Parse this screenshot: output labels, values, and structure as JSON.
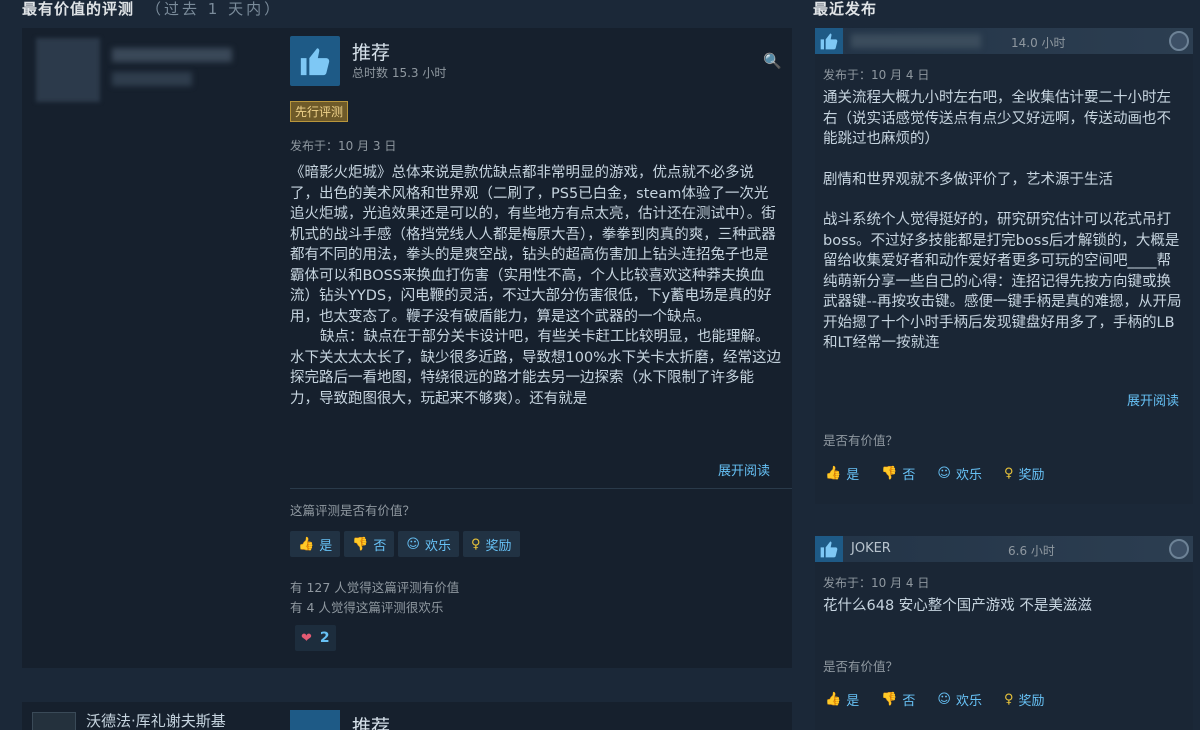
{
  "left_section": {
    "title": "最有价值的评测",
    "subtitle": "（过去 1 天内）"
  },
  "right_section": {
    "title": "最近发布"
  },
  "main_review": {
    "verdict": "推荐",
    "hours": "总时数 15.3 小时",
    "badge": "先行评测",
    "posted": "发布于：10 月 3 日",
    "paragraphs": [
      "《暗影火炬城》总体来说是款优缺点都非常明显的游戏，优点就不必多说了，出色的美术风格和世界观（二刷了，PS5已白金，steam体验了一次光追火炬城，光追效果还是可以的，有些地方有点太亮，估计还在测试中）。街机式的战斗手感（格挡党线人人都是梅原大吾），拳拳到肉真的爽，三种武器都有不同的用法，拳头的是爽空战，钻头的超高伤害加上钻头连招兔子也是霸体可以和BOSS来换血打伤害（实用性不高，个人比较喜欢这种莽夫换血流）钻头YYDS，闪电鞭的灵活，不过大部分伤害很低，下y蓄电场是真的好用，也太变态了。鞭子没有破盾能力，算是这个武器的一个缺点。",
      "缺点：缺点在于部分关卡设计吧，有些关卡赶工比较明显，也能理解。水下关太太太长了，缺少很多近路，导致想100%水下关卡太折磨，经常这边探完路后一看地图，特绕很远的路才能去另一边探索（水下限制了许多能力，导致跑图很大，玩起来不够爽）。还有就是"
    ],
    "expand": "展开阅读",
    "helpful_q": "这篇评测是否有价值？",
    "votes": {
      "yes": "是",
      "no": "否",
      "funny": "欢乐",
      "award": "奖励"
    },
    "stat1": "有 127 人觉得这篇评测有价值",
    "stat2": "有 4 人觉得这篇评测很欢乐",
    "award_count": "2"
  },
  "next_review": {
    "author": "沃德法·厍礼谢夫斯基",
    "verdict": "推荐"
  },
  "recent": [
    {
      "hours": "14.0 小时",
      "posted": "发布于：10 月 4 日",
      "paragraphs": [
        "通关流程大概九小时左右吧，全收集估计要二十小时左右（说实话感觉传送点有点少又好远啊，传送动画也不能跳过也麻烦的）",
        "剧情和世界观就不多做评价了，艺术源于生活",
        "战斗系统个人觉得挺好的，研究研究估计可以花式吊打boss。不过好多技能都是打完boss后才解锁的，大概是留给收集爱好者和动作爱好者更多可玩的空间吧____帮纯萌新分享一些自己的心得：连招记得先按方向键或换武器键--再按攻击键。感便一键手柄是真的难摁，从开局开始摁了十个小时手柄后发现键盘好用多了，手柄的LB和LT经常一按就连"
      ],
      "expand": "展开阅读",
      "q": "是否有价值？"
    },
    {
      "author": "JOKER",
      "hours": "6.6 小时",
      "posted": "发布于：10 月 4 日",
      "paragraphs": [
        "花什么648 安心整个国产游戏 不是美滋滋"
      ],
      "q": "是否有价值？"
    }
  ],
  "colors": {
    "bg": "#1b2838",
    "link": "#66c0f4",
    "thumb": "#1e5a86",
    "gold": "#e8c33a"
  }
}
